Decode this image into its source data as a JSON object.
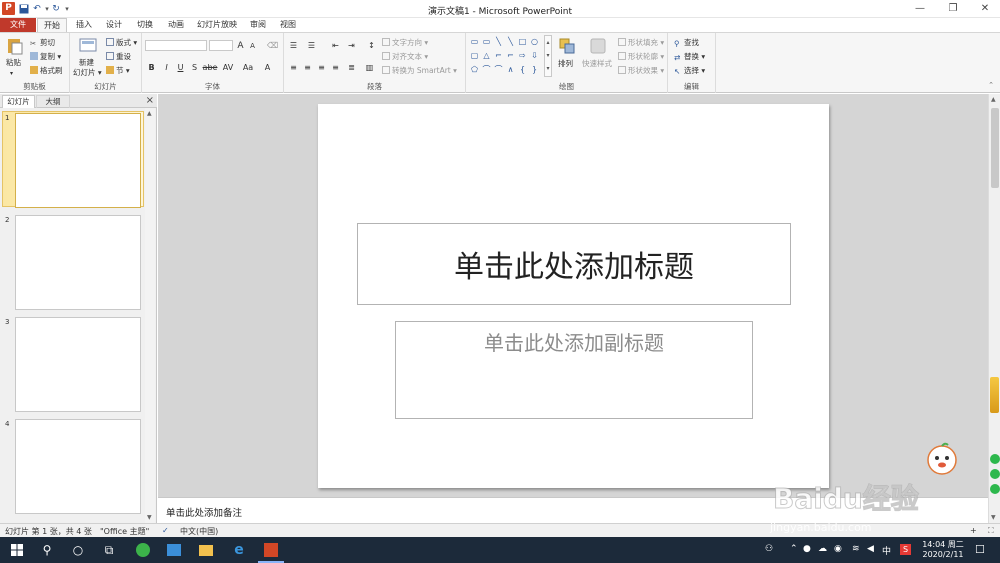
{
  "window": {
    "title": "演示文稿1 - Microsoft PowerPoint",
    "app_icon_letter": "P"
  },
  "tabs": [
    "文件",
    "开始",
    "插入",
    "设计",
    "切换",
    "动画",
    "幻灯片放映",
    "审阅",
    "视图"
  ],
  "ribbon": {
    "clipboard": {
      "paste": "粘贴",
      "cut": "剪切",
      "copy": "复制",
      "format_painter": "格式刷",
      "label": "剪贴板"
    },
    "slides": {
      "new_slide_line1": "新建",
      "new_slide_line2": "幻灯片",
      "layout": "版式",
      "reset": "重设",
      "section": "节",
      "label": "幻灯片"
    },
    "font": {
      "label": "字体",
      "bold": "B",
      "italic": "I",
      "underline": "U",
      "strike": "S",
      "shadow": "abe",
      "spacing": "AV",
      "case": "Aa",
      "color": "A",
      "grow": "A",
      "shrink": "A"
    },
    "paragraph": {
      "label": "段落",
      "text_direction": "文字方向",
      "align_text": "对齐文本",
      "smartart": "转换为 SmartArt"
    },
    "drawing": {
      "label": "绘图",
      "arrange": "排列",
      "quick_styles": "快速样式",
      "shape_fill": "形状填充",
      "shape_outline": "形状轮廓",
      "shape_effects": "形状效果"
    },
    "editing": {
      "label": "编辑",
      "find": "查找",
      "replace": "替换",
      "select": "选择"
    }
  },
  "panel": {
    "tabs": [
      "幻灯片",
      "大纲"
    ],
    "close": "×",
    "thumbnails": [
      "1",
      "2",
      "3",
      "4"
    ],
    "selected": 1
  },
  "slide": {
    "title_placeholder": "单击此处添加标题",
    "subtitle_placeholder": "单击此处添加副标题"
  },
  "notes": {
    "placeholder": "单击此处添加备注"
  },
  "status": {
    "slide_info": "幻灯片 第 1 张，共 4 张",
    "theme": "\"Office 主题\"",
    "language": "中文(中国)"
  },
  "taskbar": {
    "time": "14:04 周二",
    "date": "2020/2/11",
    "ime": "中"
  },
  "watermark": {
    "text": "Baidu经验",
    "url": "jingyan.baidu.com"
  }
}
